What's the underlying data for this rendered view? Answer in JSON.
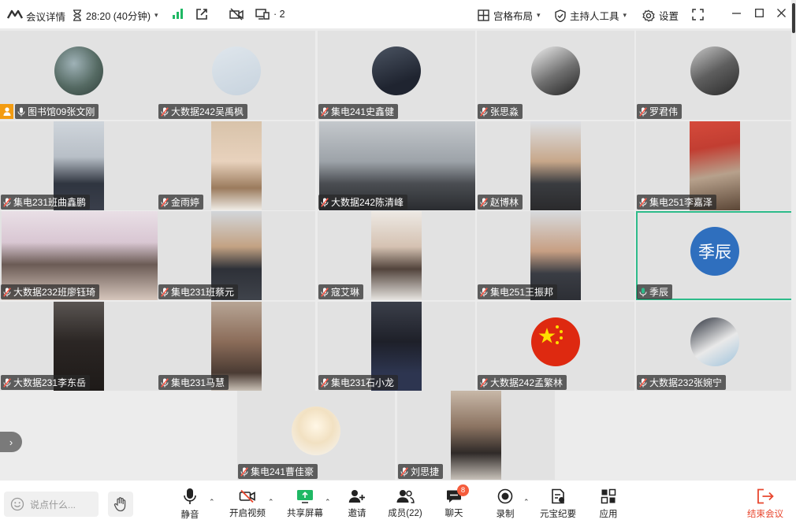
{
  "header": {
    "meeting_info": "会议详情",
    "timer": "28:20 (40分钟)",
    "device_count": "· 2",
    "layout": "宫格布局",
    "host_tools": "主持人工具",
    "settings": "设置"
  },
  "participants": [
    {
      "name": "图书馆09张文刚",
      "host": true,
      "mic": "unmuted"
    },
    {
      "name": "大数据242吴禹枫",
      "mic": "muted"
    },
    {
      "name": "集电241史鑫健",
      "mic": "muted"
    },
    {
      "name": "张思淼",
      "mic": "muted"
    },
    {
      "name": "罗君伟",
      "mic": "muted"
    },
    {
      "name": "集电231班曲鑫鹏",
      "mic": "muted"
    },
    {
      "name": "金雨婷",
      "mic": "muted"
    },
    {
      "name": "大数据242陈清峰",
      "mic": "muted"
    },
    {
      "name": "赵博林",
      "mic": "muted"
    },
    {
      "name": "集电251李嘉泽",
      "mic": "muted"
    },
    {
      "name": "大数据232班廖钰琦",
      "mic": "muted"
    },
    {
      "name": "集电231班蔡元",
      "mic": "muted"
    },
    {
      "name": "寇艾琳",
      "mic": "muted"
    },
    {
      "name": "集电251王振邦",
      "mic": "muted"
    },
    {
      "name": "季辰",
      "mic": "unmuted",
      "avatar_text": "季辰",
      "avatar_color": "#2f6fbe"
    },
    {
      "name": "大数据231李东岳",
      "mic": "muted"
    },
    {
      "name": "集电231马慧",
      "mic": "muted"
    },
    {
      "name": "集电231石小龙",
      "mic": "muted"
    },
    {
      "name": "大数据242孟繁林",
      "mic": "muted"
    },
    {
      "name": "大数据232张婉宁",
      "mic": "muted"
    },
    {
      "name": "集电241曹佳豪",
      "mic": "muted"
    },
    {
      "name": "刘思捷",
      "mic": "muted"
    }
  ],
  "toolbar": {
    "chat_placeholder": "说点什么...",
    "mute": "静音",
    "video": "开启视频",
    "share": "共享屏幕",
    "invite": "邀请",
    "members": "成员(22)",
    "chat": "聊天",
    "chat_badge": "8",
    "record": "录制",
    "ai_minutes": "元宝纪要",
    "apps": "应用",
    "leave": "结束会议"
  },
  "colors": {
    "accent": "#2dbb8a",
    "danger": "#e8472f",
    "signal": "#1fb864",
    "host_badge": "#f39c12"
  }
}
